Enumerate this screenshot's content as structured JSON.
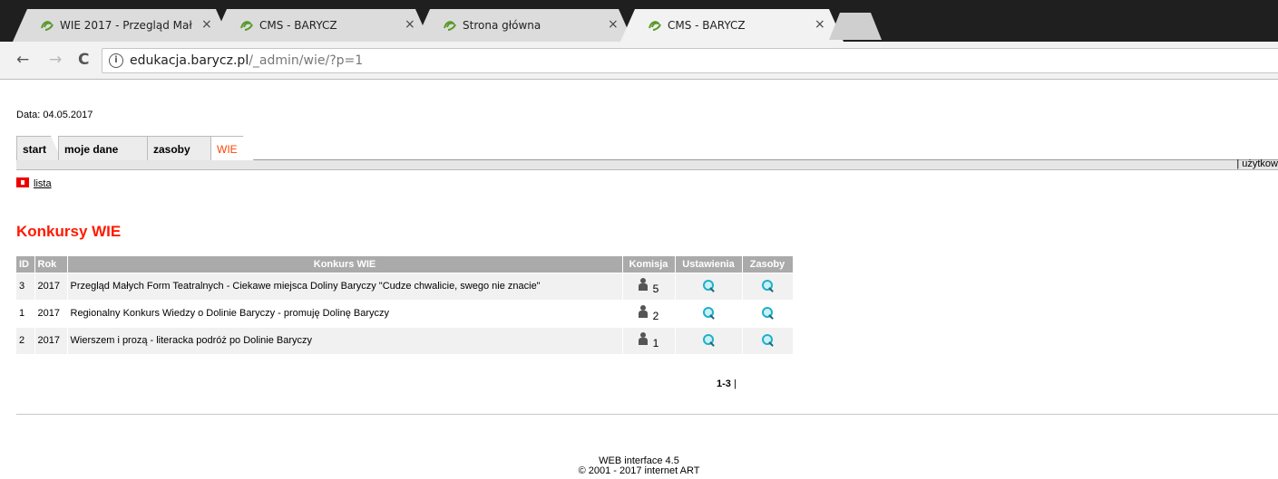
{
  "browser": {
    "tabs": [
      {
        "title": "WIE 2017 - Przegląd Mał",
        "close": "×",
        "active": false
      },
      {
        "title": "CMS - BARYCZ",
        "close": "×",
        "active": false
      },
      {
        "title": "Strona główna",
        "close": "×",
        "active": false
      },
      {
        "title": "CMS - BARYCZ",
        "close": "×",
        "active": true
      }
    ],
    "back": "←",
    "forward": "→",
    "reload": "C",
    "info": "i",
    "url_host": "edukacja.barycz.pl",
    "url_path": "/_admin/wie/?p=1"
  },
  "page": {
    "date": "Data: 04.05.2017",
    "main_tabs": [
      "start",
      "moje dane",
      "zasoby",
      "WIE"
    ],
    "users_link": "| użytkow",
    "lista_link": "lista",
    "heading": "Konkursy WIE",
    "table": {
      "headers": [
        "ID",
        "Rok",
        "Konkurs WIE",
        "Komisja",
        "Ustawienia",
        "Zasoby"
      ],
      "rows": [
        {
          "id": "3",
          "rok": "2017",
          "konkurs": "Przegląd Małych Form Teatralnych - Ciekawe miejsca Doliny Baryczy \"Cudze chwalicie, swego nie znacie\"",
          "komisja": "5"
        },
        {
          "id": "1",
          "rok": "2017",
          "konkurs": "Regionalny Konkurs Wiedzy o Dolinie Baryczy - promuję Dolinę Baryczy",
          "komisja": "2"
        },
        {
          "id": "2",
          "rok": "2017",
          "konkurs": "Wierszem i prozą - literacka podróż po Dolinie Baryczy",
          "komisja": "1"
        }
      ]
    },
    "pager": {
      "range": "1-3",
      "sep": "|"
    },
    "footer": {
      "line1": "WEB interface 4.5",
      "line2": "© 2001 - 2017 internet ART"
    }
  },
  "colors": {
    "heading": "#ff1a00",
    "active_tab": "#ff4500",
    "table_header": "#aaaaaa"
  }
}
